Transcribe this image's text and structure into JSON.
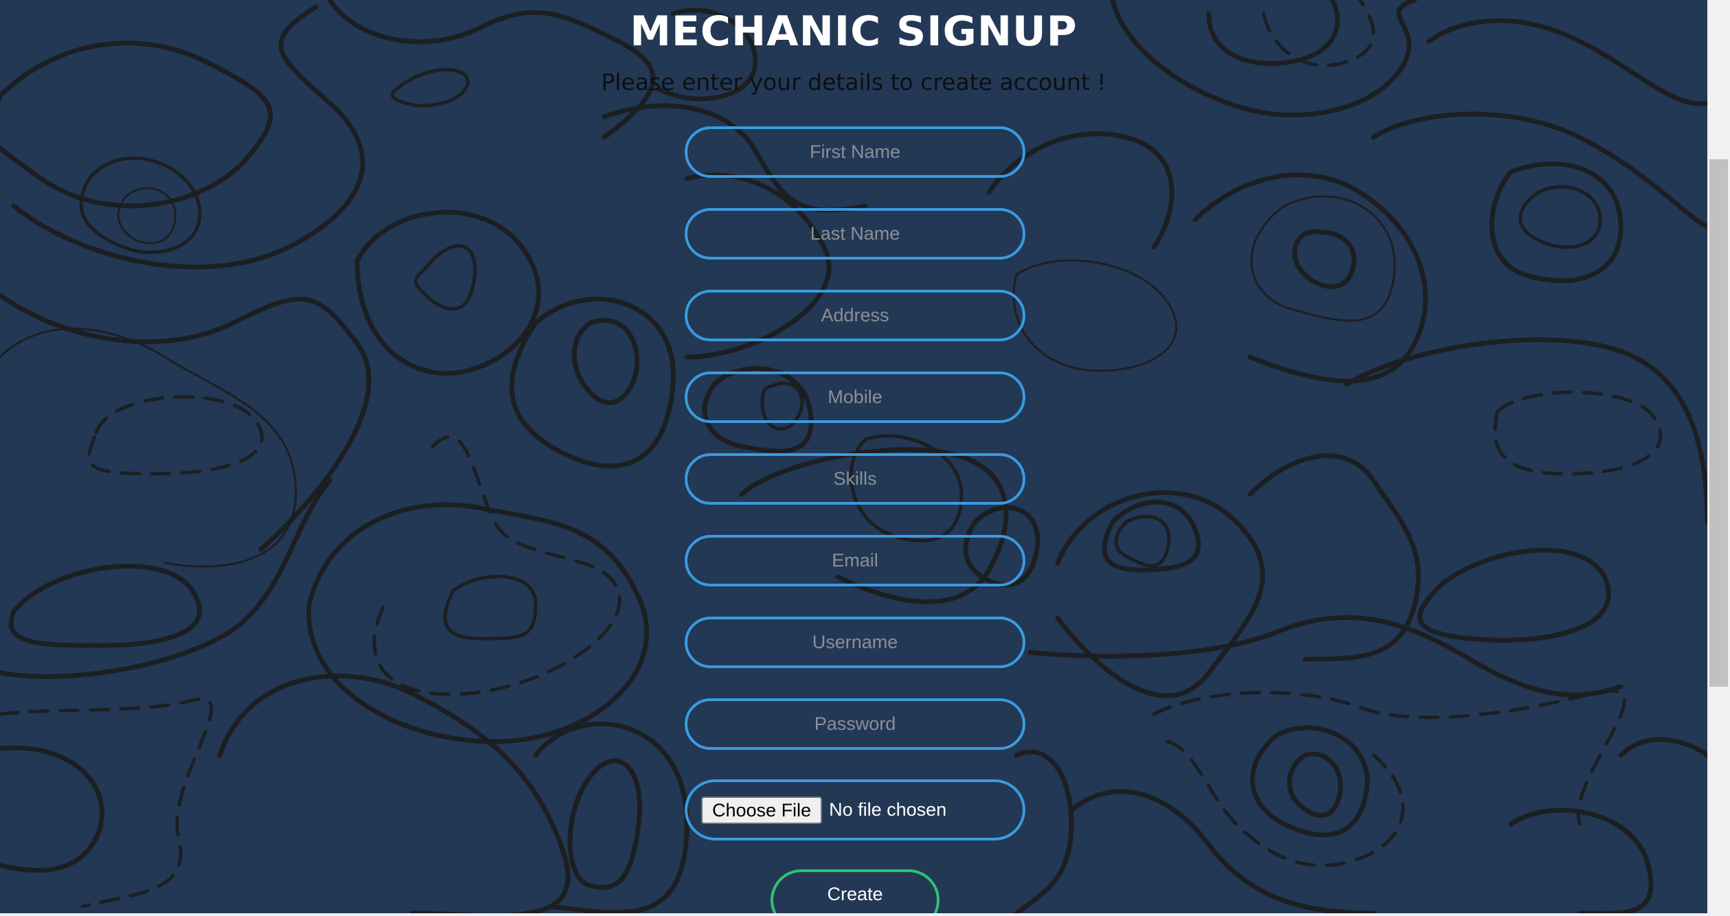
{
  "page": {
    "title": "MECHANIC SIGNUP",
    "subtitle": "Please enter your details to create account !"
  },
  "form": {
    "fields": [
      {
        "name": "first-name",
        "placeholder": "First Name",
        "value": ""
      },
      {
        "name": "last-name",
        "placeholder": "Last Name",
        "value": ""
      },
      {
        "name": "address",
        "placeholder": "Address",
        "value": ""
      },
      {
        "name": "mobile",
        "placeholder": "Mobile",
        "value": ""
      },
      {
        "name": "skills",
        "placeholder": "Skills",
        "value": ""
      },
      {
        "name": "email",
        "placeholder": "Email",
        "value": ""
      },
      {
        "name": "username",
        "placeholder": "Username",
        "value": ""
      },
      {
        "name": "password",
        "placeholder": "Password",
        "value": ""
      }
    ],
    "file": {
      "button_label": "Choose File",
      "status": "No file chosen"
    },
    "submit_label": "Create"
  },
  "colors": {
    "background": "#233855",
    "contour_lines": "#1c1f22",
    "field_border": "#3a9be0",
    "submit_border": "#2fc173",
    "title_text": "#ffffff",
    "subtitle_text": "#0d0f12"
  }
}
